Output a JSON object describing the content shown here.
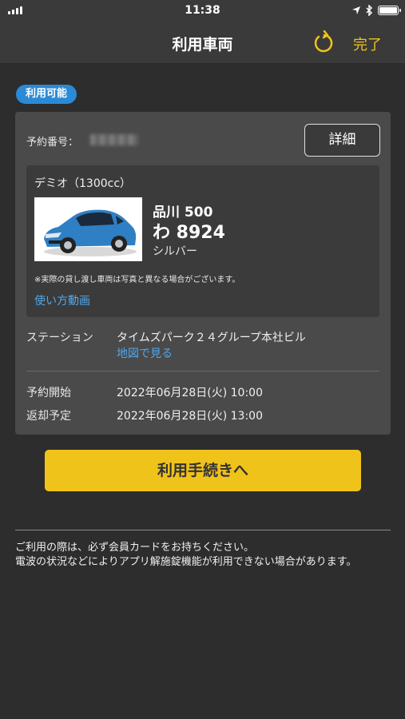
{
  "status_bar": {
    "time": "11:38"
  },
  "nav": {
    "title": "利用車両",
    "done_label": "完了",
    "refresh_icon": "refresh-icon",
    "accent": "#f0c31a"
  },
  "badge": {
    "label": "利用可能",
    "color": "#2b8ad6"
  },
  "reservation": {
    "number_label": "予約番号：",
    "detail_button": "詳細"
  },
  "vehicle": {
    "model": "デミオ（1300cc）",
    "plate_top": "品川 500",
    "plate_bottom": "わ 8924",
    "color": "シルバー",
    "photo_note": "※実際の貸し渡し車両は写真と異なる場合がございます。",
    "howto_link": "使い方動画"
  },
  "station": {
    "label": "ステーション",
    "name": "タイムズパーク２４グループ本社ビル",
    "map_link": "地図で見る"
  },
  "schedule": {
    "start_label": "予約開始",
    "start_value": "2022年06月28日(火) 10:00",
    "return_label": "返却予定",
    "return_value": "2022年06月28日(火) 13:00"
  },
  "primary_button": "利用手続きへ",
  "notice": {
    "line1": "ご利用の際は、必ず会員カードをお持ちください。",
    "line2": "電波の状況などによりアプリ解施錠機能が利用できない場合があります。"
  },
  "link_color": "#4fa8ee"
}
